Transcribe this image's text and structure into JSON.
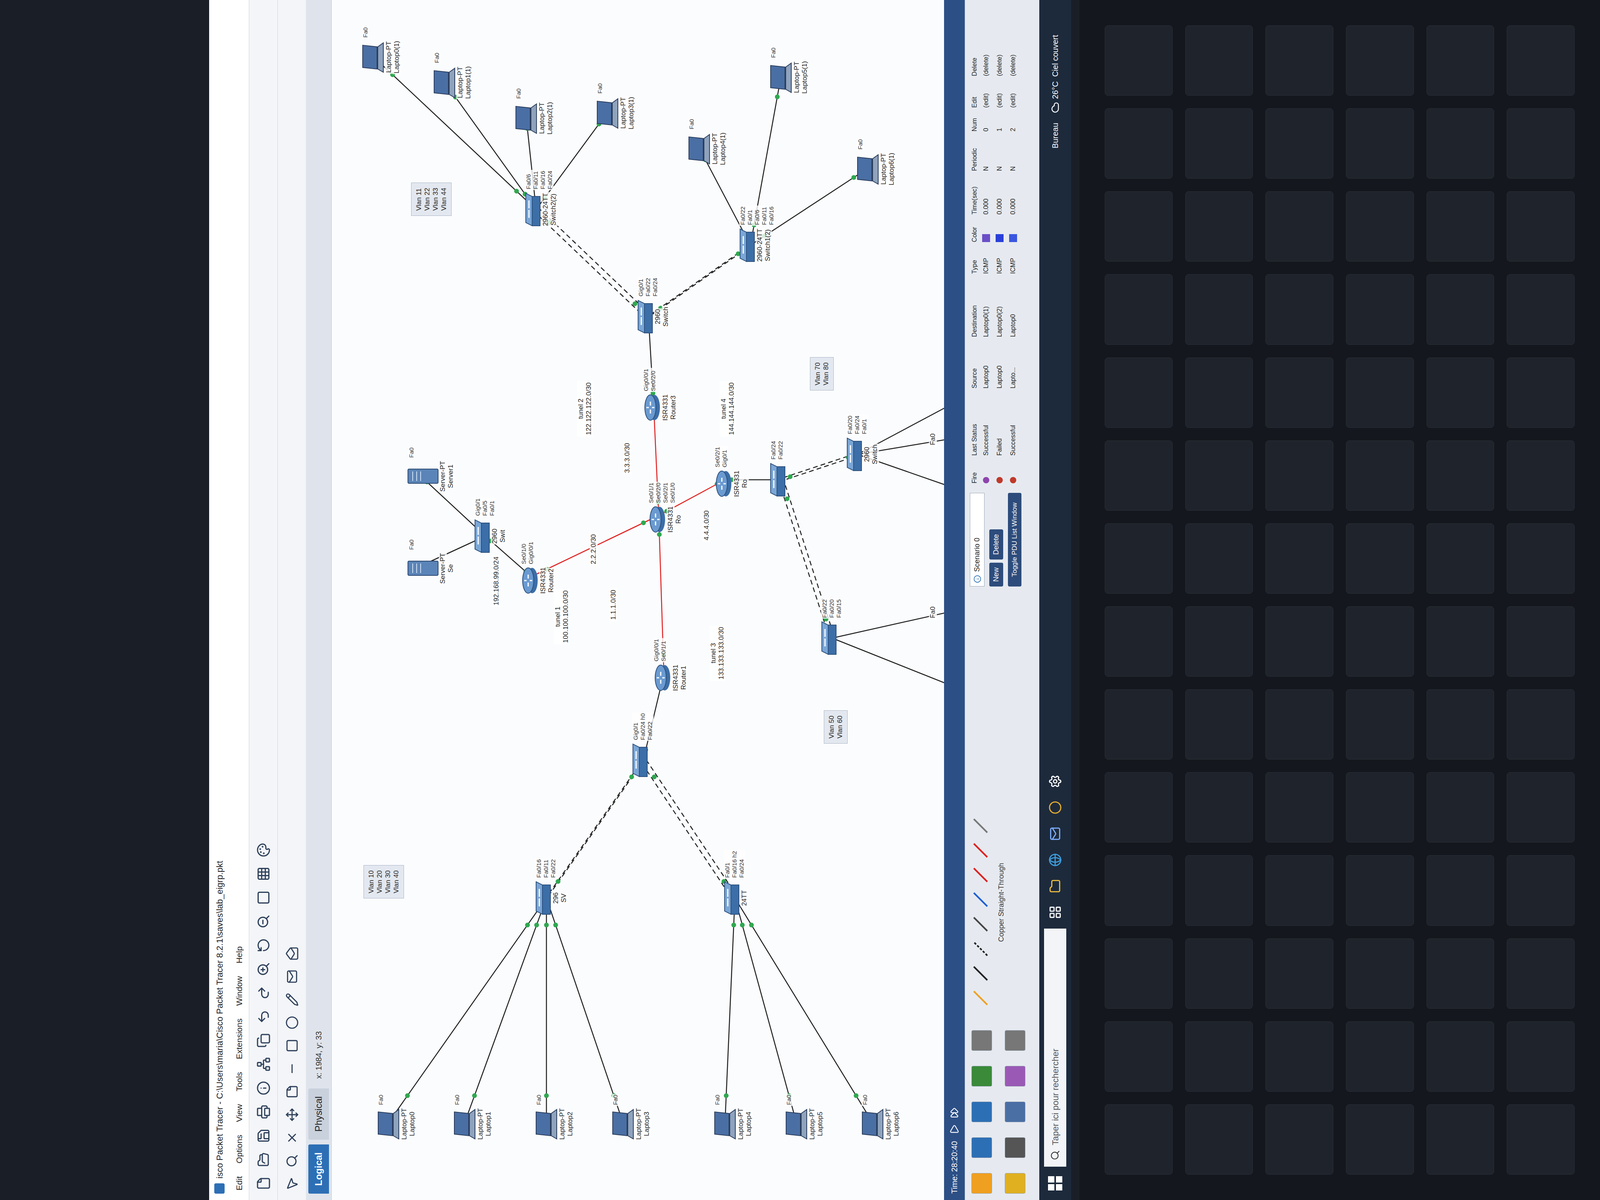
{
  "window": {
    "title": "isco Packet Tracer - C:\\Users\\maria\\Cisco Packet Tracer 8.2.1\\saves\\lab_eigrp.pkt"
  },
  "menu": [
    "Edit",
    "Options",
    "View",
    "Tools",
    "Extensions",
    "Window",
    "Help"
  ],
  "view_tabs": [
    {
      "label": "Logical",
      "selected": true
    },
    {
      "label": "Physical",
      "selected": false
    }
  ],
  "coords": "x: 1984, y: 33",
  "nodes": [
    {
      "kind": "laptop",
      "labels": [
        "Laptop-PT",
        "Laptop0"
      ],
      "ports": [
        "Fa0"
      ]
    },
    {
      "kind": "laptop",
      "labels": [
        "Laptop-PT",
        "Laptop1"
      ],
      "ports": [
        "Fa0"
      ]
    },
    {
      "kind": "laptop",
      "labels": [
        "Laptop-PT",
        "Laptop2"
      ],
      "ports": [
        "Fa0"
      ]
    },
    {
      "kind": "laptop",
      "labels": [
        "Laptop-PT",
        "Laptop3"
      ],
      "ports": [
        "Fa0"
      ]
    },
    {
      "kind": "laptop",
      "labels": [
        "Laptop-PT",
        "Laptop4"
      ],
      "ports": [
        "Fa0"
      ]
    },
    {
      "kind": "laptop",
      "labels": [
        "Laptop-PT",
        "Laptop5"
      ],
      "ports": [
        "Fa0"
      ]
    },
    {
      "kind": "laptop",
      "labels": [
        "Laptop-PT",
        "Laptop6"
      ],
      "ports": [
        "Fa0"
      ]
    },
    {
      "kind": "switch",
      "labels": [
        "296",
        "SV"
      ],
      "ports": [
        "Fa0/16",
        "Fa0/11",
        "Fa0/22"
      ]
    },
    {
      "kind": "switch",
      "labels": [
        "24TT"
      ],
      "ports": [
        "Fa0/1",
        "Fa0/16 h2",
        "Fa0/24"
      ]
    },
    {
      "kind": "switch",
      "labels": [],
      "ports": [
        "Gig0/1",
        "Fa0/24 h0",
        "Fa0/22"
      ]
    },
    {
      "kind": "router",
      "labels": [
        "ISR4331",
        "Router1"
      ],
      "ports": [
        "Gig0/0/1",
        "Se0/1/1"
      ]
    },
    {
      "kind": "router",
      "labels": [
        "ISR4331",
        "Router2"
      ],
      "ports": [
        "Se0/1/0",
        "Gig0/0/1"
      ]
    },
    {
      "kind": "switch",
      "labels": [
        "2960",
        "Swit"
      ],
      "ports": [
        "Gig0/1",
        "Fa0/5",
        "Fa0/1"
      ]
    },
    {
      "kind": "server",
      "labels": [
        "Server-PT",
        "Se"
      ],
      "ports": [
        "Fa0"
      ]
    },
    {
      "kind": "server",
      "labels": [
        "Server-PT",
        "Server1"
      ],
      "ports": [
        "Fa0"
      ]
    },
    {
      "kind": "router",
      "labels": [
        "ISR4331",
        "Ro"
      ],
      "ports": [
        "Se0/1/1",
        "Se0/2/0",
        "Se0/2/1",
        "Se0/1/0"
      ]
    },
    {
      "kind": "router",
      "labels": [
        "ISR4331",
        "Router3"
      ],
      "ports": [
        "Gig0/0/1",
        "Se0/2/0"
      ]
    },
    {
      "kind": "router",
      "labels": [
        "ISR4331",
        "Ro"
      ],
      "ports": [
        "Se0/2/1",
        "Gig0/1"
      ]
    },
    {
      "kind": "switch",
      "labels": [],
      "ports": [
        "Fa0/22",
        "Fa0/20",
        "Fa0/15"
      ]
    },
    {
      "kind": "switch",
      "labels": [],
      "ports": [
        "Fa0/24",
        "Fa0/22"
      ]
    },
    {
      "kind": "switch",
      "labels": [
        "2960",
        "Switch"
      ],
      "ports": [
        "Fa0/20",
        "Fa0/24",
        "Fa0/1"
      ]
    },
    {
      "kind": "switch",
      "labels": [
        "2960",
        "Switch"
      ],
      "ports": [
        "Gig0/1",
        "Fa0/22",
        "Fa0/24"
      ]
    },
    {
      "kind": "switch",
      "labels": [
        "2960-24TT",
        "Switch2(2)"
      ],
      "ports": [
        "Fa0/6",
        "Fa0/11",
        "Fa0/16",
        "Fa0/24"
      ]
    },
    {
      "kind": "switch",
      "labels": [
        "2960-24TT",
        "Switch1(2)"
      ],
      "ports": [
        "Fa0/22",
        "Fa0/1",
        "Fa0/6",
        "Fa0/11",
        "Fa0/16"
      ]
    },
    {
      "kind": "laptop",
      "labels": [
        "Laptop-PT",
        "Laptop0(1)"
      ],
      "ports": [
        "Fa0"
      ]
    },
    {
      "kind": "laptop",
      "labels": [
        "Laptop-PT",
        "Laptop1(1)"
      ],
      "ports": [
        "Fa0"
      ]
    },
    {
      "kind": "laptop",
      "labels": [
        "Laptop-PT",
        "Laptop2(1)"
      ],
      "ports": [
        "Fa0"
      ]
    },
    {
      "kind": "laptop",
      "labels": [
        "Laptop-PT",
        "Laptop3(1)"
      ],
      "ports": [
        "Fa0"
      ]
    },
    {
      "kind": "laptop",
      "labels": [
        "Laptop-PT",
        "Laptop4(1)"
      ],
      "ports": [
        "Fa0"
      ]
    },
    {
      "kind": "laptop",
      "labels": [
        "Laptop-PT",
        "Laptop5(1)"
      ],
      "ports": [
        "Fa0"
      ]
    },
    {
      "kind": "laptop",
      "labels": [
        "Laptop-PT",
        "Laptop6(1)"
      ],
      "ports": [
        "Fa0"
      ]
    }
  ],
  "notes": [
    {
      "lines": [
        "Vlan 10",
        "Vlan 20",
        "Vlan 30",
        "Vlan 40"
      ]
    },
    {
      "lines": [
        "Vlan 50",
        "Vlan 60"
      ]
    },
    {
      "lines": [
        "Vlan 70",
        "Vlan 80"
      ]
    },
    {
      "lines": [
        "Vlan 11",
        "Vlan 22",
        "Vlan 33",
        "Vlan 44"
      ]
    }
  ],
  "labels": [
    {
      "lines": [
        "tunel 1",
        "100.100.100.0/30"
      ]
    },
    {
      "lines": [
        "tunel 2",
        "122.122.122.0/30"
      ]
    },
    {
      "lines": [
        "tunel 3",
        "133.133.133.0/30"
      ]
    },
    {
      "lines": [
        "tunel 4",
        "144.144.144.0/30"
      ]
    },
    {
      "lines": [
        "1.1.1.0/30"
      ]
    },
    {
      "lines": [
        "2.2.2.0/30"
      ]
    },
    {
      "lines": [
        "3.3.3.0/30"
      ]
    },
    {
      "lines": [
        "4.4.4.0/30"
      ]
    },
    {
      "lines": [
        "192.168.99.0/24"
      ]
    },
    {
      "lines": [
        "Fa0"
      ]
    },
    {
      "lines": [
        "Fa0"
      ]
    }
  ],
  "simulation": {
    "time": "Time: 28:20:40",
    "connection_label": "Copper Straight-Through",
    "scenario": "Scenario 0",
    "buttons": [
      "New",
      "Delete"
    ],
    "toggle": "Toggle PDU List Window",
    "columns": [
      "Fire",
      "Last Status",
      "Source",
      "Destination",
      "Type",
      "Color",
      "Time(sec)",
      "Periodic",
      "Num",
      "Edit",
      "Delete"
    ],
    "rows": [
      {
        "fire_color": "#8e44ad",
        "status": "Successful",
        "source": "Laptop0",
        "destination": "Laptop0(1)",
        "type": "ICMP",
        "color": "#6a4fc8",
        "time": "0.000",
        "periodic": "N",
        "num": "0",
        "edit": "(edit)",
        "delete": "(delete)"
      },
      {
        "fire_color": "#c0392b",
        "status": "Failed",
        "source": "Laptop0",
        "destination": "Laptop0(2)",
        "type": "ICMP",
        "color": "#2a3fd9",
        "time": "0.000",
        "periodic": "N",
        "num": "1",
        "edit": "(edit)",
        "delete": "(delete)"
      },
      {
        "fire_color": "#c0392b",
        "status": "Successful",
        "source": "Lapto...",
        "destination": "Laptop0",
        "type": "ICMP",
        "color": "#3b57e0",
        "time": "0.000",
        "periodic": "N",
        "num": "2",
        "edit": "(edit)",
        "delete": "(delete)"
      }
    ]
  },
  "taskbar": {
    "search": "Taper ici pour rechercher",
    "weather": "26°C  Ciel couvert",
    "desktop": "Bureau"
  }
}
